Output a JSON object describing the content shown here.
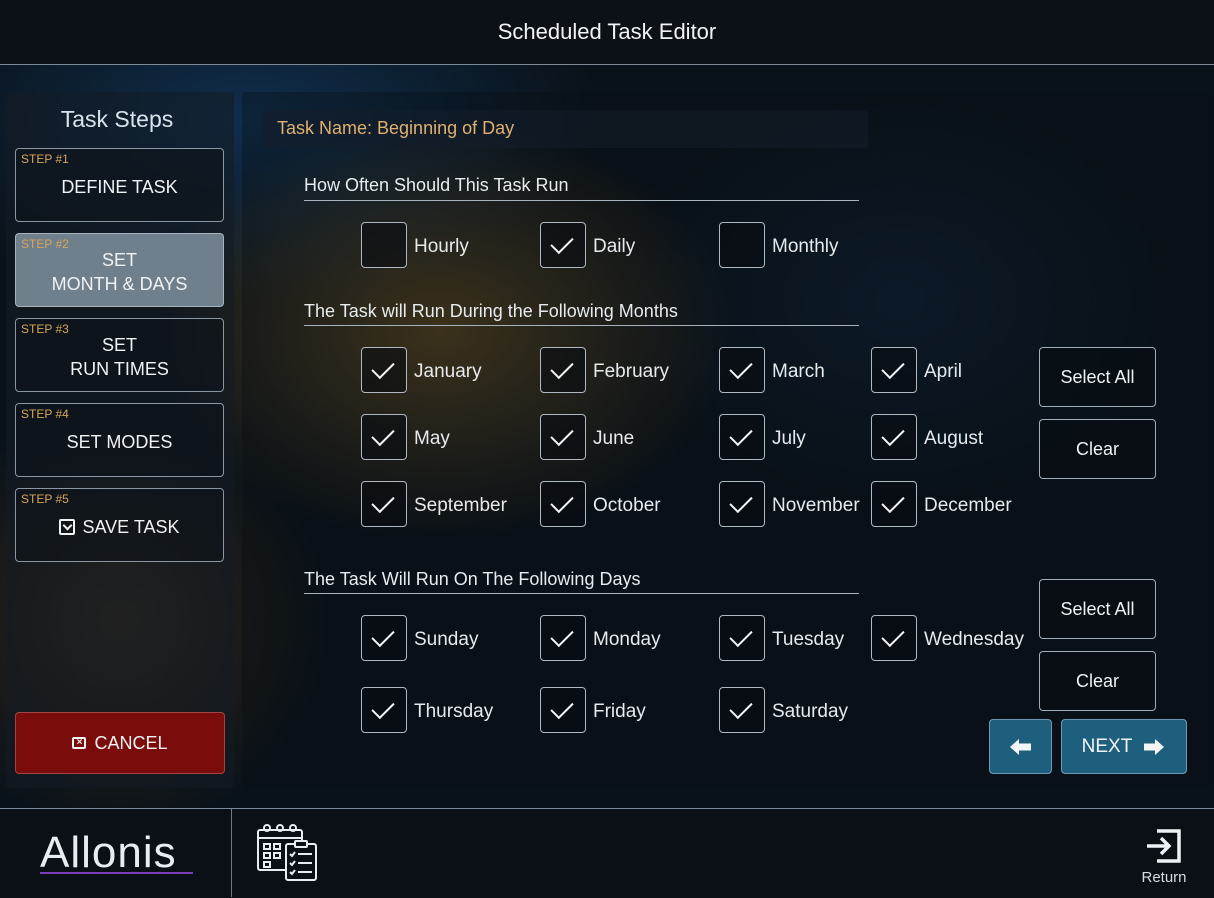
{
  "header": {
    "title": "Scheduled Task Editor"
  },
  "sidebar": {
    "title": "Task Steps",
    "steps": [
      {
        "num": "STEP #1",
        "label": "DEFINE TASK",
        "active": false
      },
      {
        "num": "STEP #2",
        "label": "SET\nMONTH & DAYS",
        "active": true
      },
      {
        "num": "STEP #3",
        "label": "SET\nRUN TIMES",
        "active": false
      },
      {
        "num": "STEP #4",
        "label": "SET MODES",
        "active": false
      },
      {
        "num": "STEP #5",
        "label": "SAVE TASK",
        "active": false,
        "icon": "save-icon"
      }
    ],
    "cancel_label": "CANCEL"
  },
  "main": {
    "task_name": "Task Name: Beginning of Day",
    "frequency": {
      "title": "How Often Should This Task Run",
      "options": [
        {
          "label": "Hourly",
          "checked": false
        },
        {
          "label": "Daily",
          "checked": true
        },
        {
          "label": "Monthly",
          "checked": false
        }
      ]
    },
    "months": {
      "title": "The Task will Run During the Following Months",
      "items": [
        {
          "label": "January",
          "checked": true
        },
        {
          "label": "February",
          "checked": true
        },
        {
          "label": "March",
          "checked": true
        },
        {
          "label": "April",
          "checked": true
        },
        {
          "label": "May",
          "checked": true
        },
        {
          "label": "June",
          "checked": true
        },
        {
          "label": "July",
          "checked": true
        },
        {
          "label": "August",
          "checked": true
        },
        {
          "label": "September",
          "checked": true
        },
        {
          "label": "October",
          "checked": true
        },
        {
          "label": "November",
          "checked": true
        },
        {
          "label": "December",
          "checked": true
        }
      ],
      "select_all_label": "Select All",
      "clear_label": "Clear"
    },
    "days": {
      "title": "The Task Will Run On The Following Days",
      "items": [
        {
          "label": "Sunday",
          "checked": true
        },
        {
          "label": "Monday",
          "checked": true
        },
        {
          "label": "Tuesday",
          "checked": true
        },
        {
          "label": "Wednesday",
          "checked": true
        },
        {
          "label": "Thursday",
          "checked": true
        },
        {
          "label": "Friday",
          "checked": true
        },
        {
          "label": "Saturday",
          "checked": true
        }
      ],
      "select_all_label": "Select All",
      "clear_label": "Clear"
    },
    "next_label": "NEXT"
  },
  "footer": {
    "logo_text": "Allonis",
    "return_label": "Return"
  },
  "colors": {
    "accent_blue": "#1f5f7e",
    "cancel_red": "#7b0c0c",
    "step_number": "#d8a55a",
    "task_name": "#e0b070",
    "logo_underline": "#7b3fb8"
  }
}
